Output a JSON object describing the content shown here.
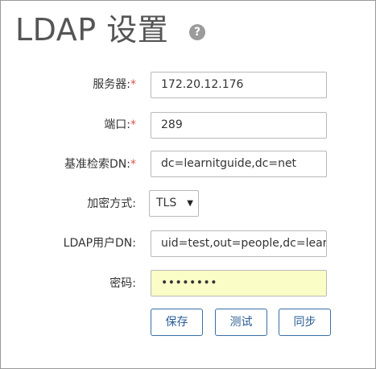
{
  "header": {
    "title": "LDAP 设置",
    "help_icon": "?"
  },
  "form": {
    "server": {
      "label": "服务器:",
      "required_mark": "*",
      "value": "172.20.12.176"
    },
    "port": {
      "label": "端口:",
      "required_mark": "*",
      "value": "289"
    },
    "base_dn": {
      "label": "基准检索DN:",
      "required_mark": "*",
      "value": "dc=learnitguide,dc=net"
    },
    "encryption": {
      "label": "加密方式:",
      "selected": "TLS",
      "arrow": "▼"
    },
    "user_dn": {
      "label": "LDAP用户DN:",
      "value": "uid=test,out=people,dc=learnitguide"
    },
    "password": {
      "label": "密码:",
      "masked": "••••••••"
    }
  },
  "buttons": {
    "save": "保存",
    "test": "测试",
    "sync": "同步"
  },
  "colors": {
    "required": "#d9534f",
    "button_border": "#3a6ea5",
    "password_bg": "#fafdc6"
  }
}
